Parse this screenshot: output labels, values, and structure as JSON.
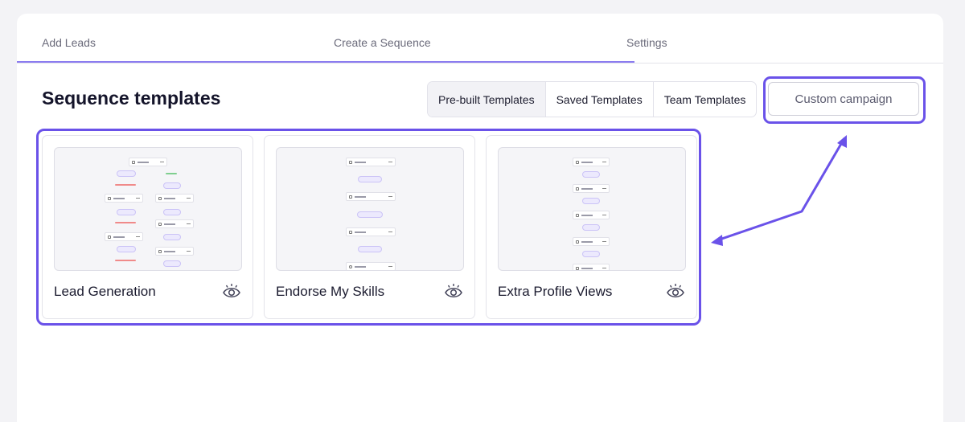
{
  "steps": [
    {
      "label": "Add Leads"
    },
    {
      "label": "Create a Sequence"
    },
    {
      "label": "Settings"
    }
  ],
  "page_title": "Sequence templates",
  "tabs": [
    {
      "label": "Pre-built Templates",
      "active": true
    },
    {
      "label": "Saved Templates",
      "active": false
    },
    {
      "label": "Team Templates",
      "active": false
    }
  ],
  "custom_campaign_label": "Custom campaign",
  "cards": [
    {
      "name": "Lead Generation",
      "icon": "eye-icon"
    },
    {
      "name": "Endorse My Skills",
      "icon": "eye-icon"
    },
    {
      "name": "Extra Profile Views",
      "icon": "eye-icon"
    }
  ],
  "colors": {
    "highlight": "#6a52e9",
    "progress": "#8b7cf0"
  }
}
